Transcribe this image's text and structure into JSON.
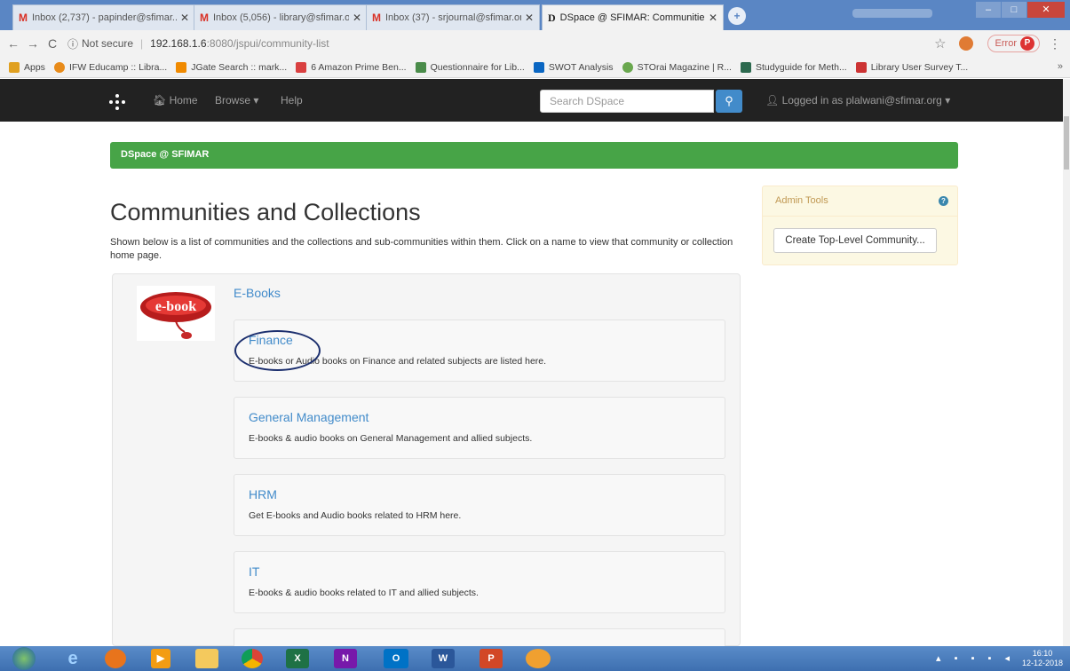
{
  "browser": {
    "tabs": [
      {
        "icon": "gmail-icon",
        "favicon": "M",
        "title": "Inbox (2,737) - papinder@sfimar..."
      },
      {
        "icon": "gmail-icon",
        "favicon": "M",
        "title": "Inbox (5,056) - library@sfimar.or..."
      },
      {
        "icon": "gmail-icon",
        "favicon": "M",
        "title": "Inbox (37) - srjournal@sfimar.org..."
      },
      {
        "icon": "dspace-icon",
        "favicon": "D",
        "title": "DSpace @ SFIMAR: Communitie..."
      }
    ],
    "address": {
      "security": "Not secure",
      "host": "192.168.1.6",
      "path": ":8080/jspui/community-list"
    },
    "error_label": "Error",
    "profile_initial": "P",
    "bookmarks": [
      {
        "label": "Apps",
        "color": "#e0a020"
      },
      {
        "label": "IFW Educamp :: Libra...",
        "color": "#e88b1a"
      },
      {
        "label": "JGate Search :: mark...",
        "color": "#f08a00"
      },
      {
        "label": "6 Amazon Prime Ben...",
        "color": "#d94040"
      },
      {
        "label": "Questionnaire for Lib...",
        "color": "#4a8c4a"
      },
      {
        "label": "SWOT Analysis",
        "color": "#0a66c2"
      },
      {
        "label": "STOrai Magazine | R...",
        "color": "#6aa84f"
      },
      {
        "label": "Studyguide for Meth...",
        "color": "#2d6a4f"
      },
      {
        "label": "Library User Survey T...",
        "color": "#c33"
      }
    ],
    "bookmarks_more": "»"
  },
  "dspace": {
    "nav": {
      "home": "Home",
      "browse": "Browse",
      "help": "Help"
    },
    "search_placeholder": "Search DSpace",
    "login": "Logged in as plalwani@sfimar.org",
    "breadcrumb": "DSpace @ SFIMAR",
    "heading": "Communities and Collections",
    "intro": "Shown below is a list of communities and the collections and sub-communities within them. Click on a name to view that community or collection home page.",
    "community": {
      "logo_text": "e-book",
      "title": "E-Books",
      "collections": [
        {
          "title": "Finance",
          "desc": "E-books or Audio books on Finance and related subjects are listed here."
        },
        {
          "title": "General Management",
          "desc": "E-books & audio books on General Management and allied subjects."
        },
        {
          "title": "HRM",
          "desc": "Get E-books and Audio books related to HRM here."
        },
        {
          "title": "IT",
          "desc": "E-books & audio books related to IT and allied subjects."
        }
      ]
    },
    "admin": {
      "title": "Admin Tools",
      "create_button": "Create Top-Level Community..."
    }
  },
  "taskbar": {
    "apps": [
      "Internet Explorer",
      "Firefox",
      "Media Player",
      "Explorer",
      "Chrome",
      "Excel",
      "OneNote",
      "Outlook",
      "Word",
      "PowerPoint",
      "Other"
    ],
    "time": "16:10",
    "date": "12-12-2018"
  }
}
